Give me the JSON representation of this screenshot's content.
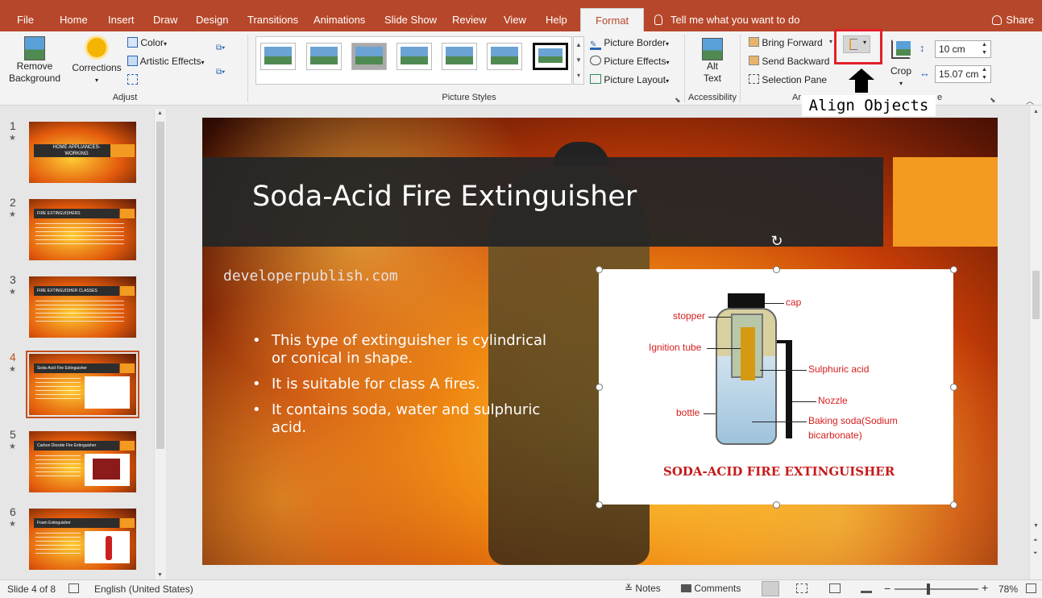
{
  "tabs": {
    "file": "File",
    "home": "Home",
    "insert": "Insert",
    "draw": "Draw",
    "design": "Design",
    "transitions": "Transitions",
    "animations": "Animations",
    "slideshow": "Slide Show",
    "review": "Review",
    "view": "View",
    "help": "Help",
    "format": "Format",
    "tell": "Tell me what you want to do",
    "share": "Share"
  },
  "ribbon": {
    "remove_bg_1": "Remove",
    "remove_bg_2": "Background",
    "corrections": "Corrections",
    "color": "Color",
    "artistic": "Artistic Effects",
    "adjust": "Adjust",
    "picture_styles": "Picture Styles",
    "picture_border": "Picture Border",
    "picture_effects": "Picture Effects",
    "picture_layout": "Picture Layout",
    "alt_1": "Alt",
    "alt_2": "Text",
    "accessibility": "Accessibility",
    "bring_forward": "Bring Forward",
    "send_backward": "Send Backward",
    "selection_pane": "Selection Pane",
    "arrange_partial": "Ar",
    "crop": "Crop",
    "size_partial": "e",
    "height": "10 cm",
    "width": "15.07 cm"
  },
  "annotation": {
    "align_objects": "Align Objects"
  },
  "slides": [
    {
      "num": "1",
      "title": "HOME APPLIANCES- WORKING"
    },
    {
      "num": "2",
      "title": "FIRE EXTINGUISHERS"
    },
    {
      "num": "3",
      "title": "FIRE EXTINGUISHER CLASSES"
    },
    {
      "num": "4",
      "title": "Soda-Acid Fire Extinguisher"
    },
    {
      "num": "5",
      "title": "Carbon Dioxide Fire Extinguisher"
    },
    {
      "num": "6",
      "title": "Foam Extinguisher"
    }
  ],
  "slide": {
    "title": "Soda-Acid Fire Extinguisher",
    "watermark": "developerpublish.com",
    "bullets": [
      "This type of extinguisher is cylindrical or conical in shape.",
      "It is suitable for class A fires.",
      "It contains soda, water and sulphuric acid."
    ],
    "diagram": {
      "cap": "cap",
      "stopper": "stopper",
      "ignition": "Ignition tube",
      "sulphuric": "Sulphuric acid",
      "nozzle": "Nozzle",
      "bottle": "bottle",
      "baking1": "Baking soda(Sodium",
      "baking2": "bicarbonate)",
      "caption": "SODA-ACID FIRE EXTINGUISHER"
    }
  },
  "status": {
    "slide": "Slide 4 of 8",
    "language": "English (United States)",
    "notes": "Notes",
    "comments": "Comments",
    "zoom": "78%"
  }
}
